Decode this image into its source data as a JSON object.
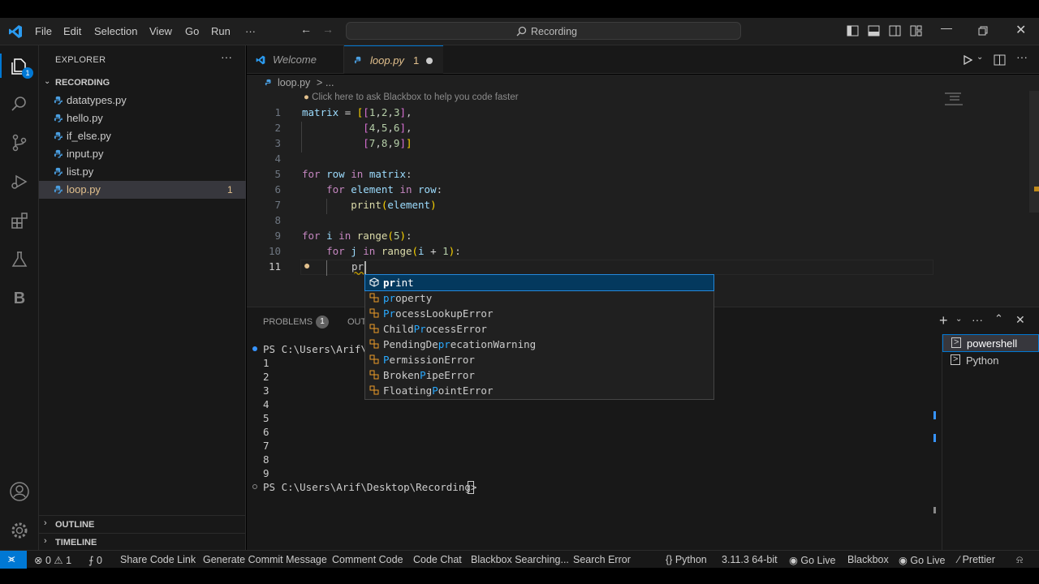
{
  "menu": {
    "file": "File",
    "edit": "Edit",
    "selection": "Selection",
    "view": "View",
    "go": "Go",
    "run": "Run",
    "more": "···"
  },
  "search": {
    "text": "Recording"
  },
  "explorer": {
    "title": "EXPLORER",
    "folder": "RECORDING",
    "files": [
      {
        "name": "datatypes.py"
      },
      {
        "name": "hello.py"
      },
      {
        "name": "if_else.py"
      },
      {
        "name": "input.py"
      },
      {
        "name": "list.py"
      },
      {
        "name": "loop.py",
        "badge": "1"
      }
    ],
    "outline": "OUTLINE",
    "timeline": "TIMELINE"
  },
  "activity_badge": "1",
  "activity_b_label": "B",
  "tabs": [
    {
      "label": "Welcome"
    },
    {
      "label": "loop.py",
      "badge": "1"
    }
  ],
  "breadcrumbs": {
    "file": "loop.py",
    "sep": ">",
    "more": "..."
  },
  "editor": {
    "hint": "Click here to ask Blackbox to help you code faster",
    "line_numbers": [
      "1",
      "2",
      "3",
      "4",
      "5",
      "6",
      "7",
      "8",
      "9",
      "10",
      "11"
    ],
    "typed": "pr"
  },
  "suggestions": [
    {
      "label": "print",
      "match": "pr",
      "rest": "int"
    },
    {
      "label": "property",
      "match": "pr",
      "rest": "operty"
    },
    {
      "label": "ProcessLookupError",
      "pre": "",
      "match": "Pr",
      "rest": "ocessLookupError"
    },
    {
      "label": "ChildProcessError",
      "pre": "Child",
      "match": "Pr",
      "rest": "ocessError"
    },
    {
      "label": "PendingDeprecationWarning",
      "pre": "PendingDe",
      "match": "pr",
      "rest": "ecationWarning"
    },
    {
      "label": "PermissionError",
      "pre": "",
      "match": "P",
      "rest": "ermissionError"
    },
    {
      "label": "BrokenPipeError",
      "pre": "Broken",
      "match": "P",
      "rest": "ipeError"
    },
    {
      "label": "FloatingPointError",
      "pre": "Floating",
      "match": "P",
      "rest": "ointError"
    }
  ],
  "panel": {
    "problems": "PROBLEMS",
    "problems_count": "1",
    "output": "OUT",
    "prompt1": "PS C:\\Users\\Arif\\D",
    "outputs": [
      "1",
      "2",
      "3",
      "4",
      "5",
      "6",
      "7",
      "8",
      "9"
    ],
    "prompt2": "PS C:\\Users\\Arif\\Desktop\\Recording>",
    "terminals": [
      "powershell",
      "Python"
    ]
  },
  "status": {
    "errors": "0",
    "warnings": "1",
    "ports": "0",
    "share": "Share Code Link",
    "commit": "Generate Commit Message",
    "comment": "Comment Code",
    "chat": "Code Chat",
    "searching": "Blackbox Searching...",
    "search_error": "Search Error",
    "lang": "Python",
    "version": "3.11.3 64-bit",
    "golive1": "Go Live",
    "blackbox": "Blackbox",
    "golive2": "Go Live",
    "prettier": "Prettier"
  },
  "colors": {
    "accent": "#0078d4",
    "selection": "#04395e",
    "keyword": "#c586c0",
    "variable": "#9cdcfe",
    "function": "#dcdcaa"
  }
}
